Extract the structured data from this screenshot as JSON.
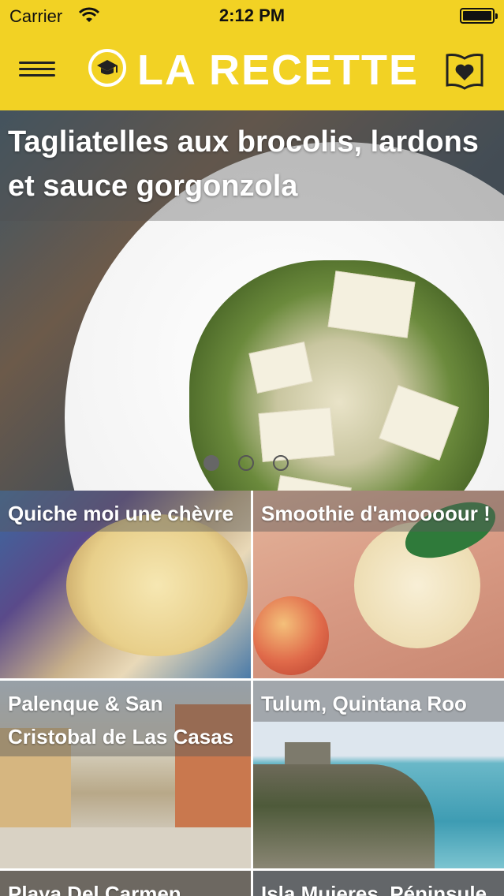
{
  "status_bar": {
    "carrier": "Carrier",
    "time": "2:12 PM"
  },
  "header": {
    "logo_text": "LA RECETTE",
    "icons": {
      "menu": "hamburger-menu-icon",
      "logo": "graduation-cap-icon",
      "favorites": "heart-book-icon"
    }
  },
  "colors": {
    "brand_yellow": "#f2d224",
    "text_white": "#ffffff"
  },
  "featured": {
    "title": "Tagliatelles aux brocolis, lardons et sauce gorgonzola",
    "page_count": 3,
    "active_page": 1
  },
  "recipes": [
    {
      "title": "Quiche moi une chèvre"
    },
    {
      "title": "Smoothie d'amoooour !"
    },
    {
      "title": "Palenque & San Cristobal de Las Casas"
    },
    {
      "title": "Tulum, Quintana Roo"
    },
    {
      "title": "Playa Del Carmen"
    },
    {
      "title": "Isla Mujeres, Péninsule"
    }
  ]
}
